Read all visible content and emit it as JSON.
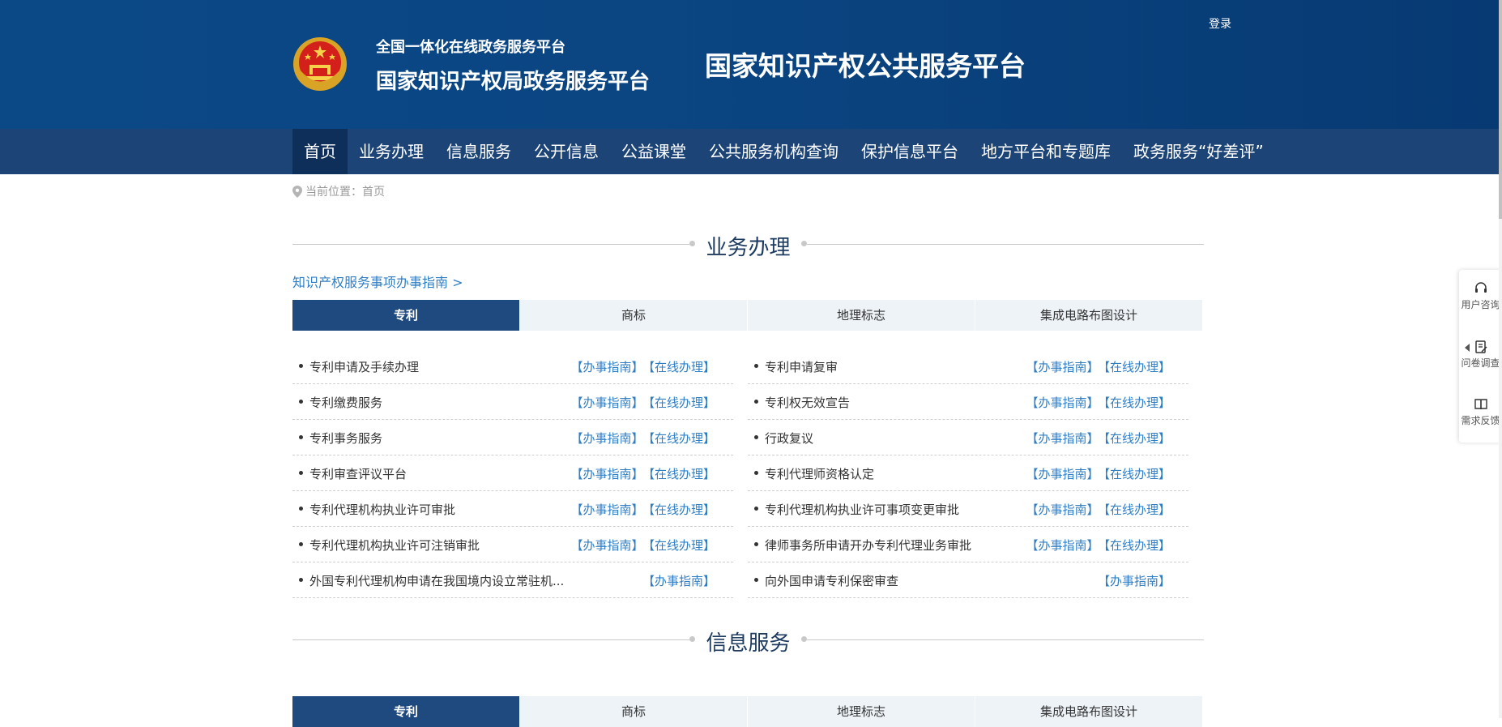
{
  "header": {
    "brand_line1": "全国一体化在线政务服务平台",
    "brand_line2": "国家知识产权局政务服务平台",
    "platform_title": "国家知识产权公共服务平台",
    "login": "登录"
  },
  "nav": {
    "items": [
      {
        "label": "首页",
        "active": true
      },
      {
        "label": "业务办理"
      },
      {
        "label": "信息服务"
      },
      {
        "label": "公开信息"
      },
      {
        "label": "公益课堂"
      },
      {
        "label": "公共服务机构查询"
      },
      {
        "label": "保护信息平台"
      },
      {
        "label": "地方平台和专题库"
      },
      {
        "label": "政务服务“好差评”"
      }
    ]
  },
  "breadcrumb": {
    "text": "当前位置：首页"
  },
  "business": {
    "title": "业务办理",
    "guide_link": "知识产权服务事项办事指南 >",
    "tabs": [
      "专利",
      "商标",
      "地理标志",
      "集成电路布图设计"
    ],
    "guide_label": "【办事指南】",
    "online_label": "【在线办理】",
    "left": [
      {
        "name": "专利申请及手续办理",
        "online": true
      },
      {
        "name": "专利缴费服务",
        "online": true
      },
      {
        "name": "专利事务服务",
        "online": true
      },
      {
        "name": "专利审查评议平台",
        "online": true
      },
      {
        "name": "专利代理机构执业许可审批",
        "online": true
      },
      {
        "name": "专利代理机构执业许可注销审批",
        "online": true
      },
      {
        "name": "外国专利代理机构申请在我国境内设立常驻机...",
        "online": false
      }
    ],
    "right": [
      {
        "name": "专利申请复审",
        "online": true
      },
      {
        "name": "专利权无效宣告",
        "online": true
      },
      {
        "name": "行政复议",
        "online": true
      },
      {
        "name": "专利代理师资格认定",
        "online": true
      },
      {
        "name": "专利代理机构执业许可事项变更审批",
        "online": true
      },
      {
        "name": "律师事务所申请开办专利代理业务审批",
        "online": true
      },
      {
        "name": "向外国申请专利保密审查",
        "online": false
      }
    ]
  },
  "info": {
    "title": "信息服务",
    "tabs": [
      "专利",
      "商标",
      "地理标志",
      "集成电路布图设计"
    ]
  },
  "side_panel": {
    "items": [
      {
        "label": "用户咨询",
        "icon": "headset-icon"
      },
      {
        "label": "问卷调查",
        "icon": "survey-icon"
      },
      {
        "label": "需求反馈",
        "icon": "feedback-icon"
      }
    ]
  },
  "colors": {
    "header_bg": "#0b4886",
    "nav_bg": "#1c4476",
    "nav_active": "#0e2f59",
    "tab_active": "#1f4a7f",
    "link": "#2f7ec4"
  }
}
